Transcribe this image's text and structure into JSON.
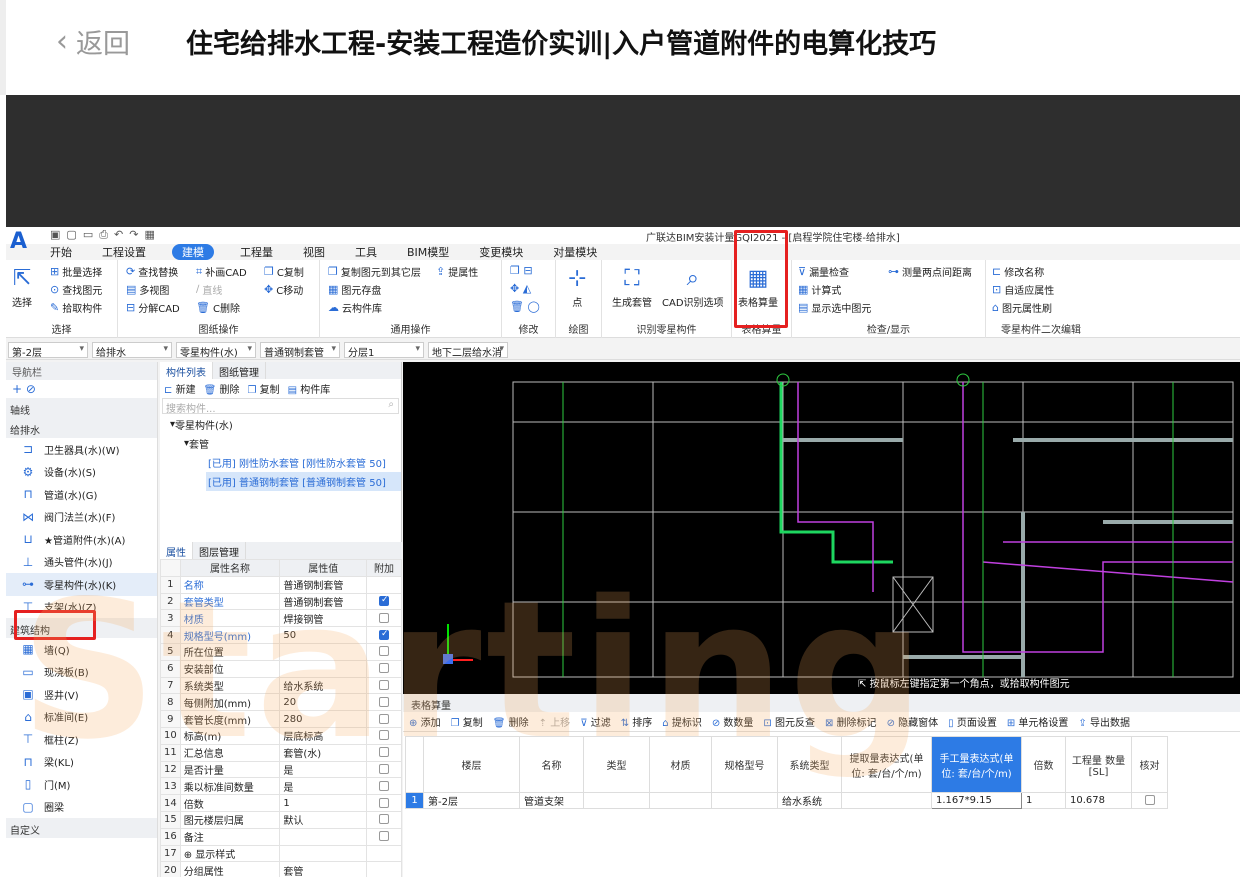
{
  "page": {
    "back_label": "返回",
    "title": "住宅给排水工程-安装工程造价实训|入户管道附件的电算化技巧"
  },
  "app": {
    "title": "广联达BIM安装计量GQI2021 - [启程学院住宅楼-给排水]",
    "menu": [
      "开始",
      "工程设置",
      "建模",
      "工程量",
      "视图",
      "工具",
      "BIM模型",
      "变更模块",
      "对量模块"
    ],
    "active_menu": "建模"
  },
  "ribbon": {
    "select": {
      "button": "选择",
      "items": [
        "批量选择",
        "查找图元",
        "拾取构件"
      ],
      "label": "选择"
    },
    "drawing_ops": {
      "items": [
        "查找替换",
        "多视图",
        "分解CAD",
        "补画CAD",
        "直线",
        "C删除",
        "C复制",
        "C移动"
      ],
      "label": "图纸操作"
    },
    "common_ops": {
      "items": [
        "复制图元到其它层",
        "提属性",
        "图元存盘",
        "云构件库"
      ],
      "label": "通用操作"
    },
    "modify": {
      "label": "修改"
    },
    "draw": {
      "button": "点",
      "label": "绘图"
    },
    "identify": {
      "buttons": [
        "生成套管",
        "CAD识别选项"
      ],
      "label": "识别零星构件"
    },
    "table_calc": {
      "button": "表格算量",
      "label": "表格算量"
    },
    "check": {
      "items": [
        "漏量检查",
        "计算式",
        "显示选中图元",
        "测量两点间距离"
      ],
      "label": "检查/显示"
    },
    "edit2": {
      "items": [
        "修改名称",
        "自适应属性",
        "图元属性刷"
      ],
      "label": "零星构件二次编辑"
    }
  },
  "filters": [
    "第-2层",
    "给排水",
    "零星构件(水)",
    "普通钢制套管",
    "分层1",
    "地下二层给水消"
  ],
  "nav": {
    "header": "导航栏",
    "sections": {
      "axis": "轴线",
      "water": "给排水",
      "building": "建筑结构",
      "custom": "自定义"
    },
    "water_items": [
      "卫生器具(水)(W)",
      "设备(水)(S)",
      "管道(水)(G)",
      "阀门法兰(水)(F)",
      "★管道附件(水)(A)",
      "通头管件(水)(J)",
      "零星构件(水)(K)",
      "支架(水)(Z)"
    ],
    "building_items": [
      "墙(Q)",
      "现浇板(B)",
      "竖井(V)",
      "标准间(E)",
      "框柱(Z)",
      "梁(KL)",
      "门(M)",
      "圈梁"
    ]
  },
  "component_list": {
    "tabs": [
      "构件列表",
      "图纸管理"
    ],
    "tools": [
      "新建",
      "删除",
      "复制",
      "构件库"
    ],
    "search_placeholder": "搜索构件...",
    "tree": {
      "root": "零星构件(水)",
      "group": "套管",
      "items": [
        "[已用] 刚性防水套管 [刚性防水套管 50]",
        "[已用] 普通钢制套管 [普通钢制套管 50]"
      ]
    }
  },
  "properties": {
    "tabs": [
      "属性",
      "图层管理"
    ],
    "headers": [
      "属性名称",
      "属性值",
      "附加"
    ],
    "rows": [
      {
        "n": "1",
        "name": "名称",
        "value": "普通钢制套管",
        "blue": true,
        "cb": ""
      },
      {
        "n": "2",
        "name": "套管类型",
        "value": "普通钢制套管",
        "blue": true,
        "cb": "on"
      },
      {
        "n": "3",
        "name": "材质",
        "value": "焊接钢管",
        "blue": true,
        "cb": "off"
      },
      {
        "n": "4",
        "name": "规格型号(mm)",
        "value": "50",
        "blue": true,
        "cb": "on"
      },
      {
        "n": "5",
        "name": "所在位置",
        "value": "",
        "blue": false,
        "cb": "off"
      },
      {
        "n": "6",
        "name": "安装部位",
        "value": "",
        "blue": false,
        "cb": "off"
      },
      {
        "n": "7",
        "name": "系统类型",
        "value": "给水系统",
        "blue": false,
        "cb": "off"
      },
      {
        "n": "8",
        "name": "每侧附加(mm)",
        "value": "20",
        "blue": false,
        "cb": "off"
      },
      {
        "n": "9",
        "name": "套管长度(mm)",
        "value": "280",
        "blue": false,
        "cb": "off"
      },
      {
        "n": "10",
        "name": "标高(m)",
        "value": "层底标高",
        "blue": false,
        "cb": "off"
      },
      {
        "n": "11",
        "name": "汇总信息",
        "value": "套管(水)",
        "blue": false,
        "cb": "off"
      },
      {
        "n": "12",
        "name": "是否计量",
        "value": "是",
        "blue": false,
        "cb": "off"
      },
      {
        "n": "13",
        "name": "乘以标准间数量",
        "value": "是",
        "blue": false,
        "cb": "off"
      },
      {
        "n": "14",
        "name": "倍数",
        "value": "1",
        "blue": false,
        "cb": "off"
      },
      {
        "n": "15",
        "name": "图元楼层归属",
        "value": "默认",
        "blue": false,
        "cb": "off"
      },
      {
        "n": "16",
        "name": "备注",
        "value": "",
        "blue": false,
        "cb": "off"
      },
      {
        "n": "17",
        "name": "⊕ 显示样式",
        "value": "",
        "blue": false,
        "cb": ""
      },
      {
        "n": "20",
        "name": "分组属性",
        "value": "套管",
        "blue": false,
        "cb": ""
      }
    ]
  },
  "cad": {
    "tip": "按鼠标左键指定第一个角点，或拾取构件图元"
  },
  "table_calc": {
    "header": "表格算量",
    "tools": [
      "添加",
      "复制",
      "删除",
      "上移",
      "过滤",
      "排序",
      "提标识",
      "数数量",
      "图元反查",
      "删除标记",
      "隐藏窗体",
      "页面设置",
      "单元格设置",
      "导出数据"
    ],
    "columns": [
      "楼层",
      "名称",
      "类型",
      "材质",
      "规格型号",
      "系统类型",
      "提取量表达式(单位: 套/台/个/m)",
      "手工量表达式(单位: 套/台/个/m)",
      "倍数",
      "工程量 数量 [SL]",
      "核对"
    ],
    "rows": [
      {
        "idx": "1",
        "floor": "第-2层",
        "name": "管道支架",
        "type": "",
        "material": "",
        "spec": "",
        "system": "给水系统",
        "extract": "",
        "manual": "1.167*9.15",
        "multiple": "1",
        "qty": "10.678"
      }
    ]
  },
  "watermark": "Starting"
}
